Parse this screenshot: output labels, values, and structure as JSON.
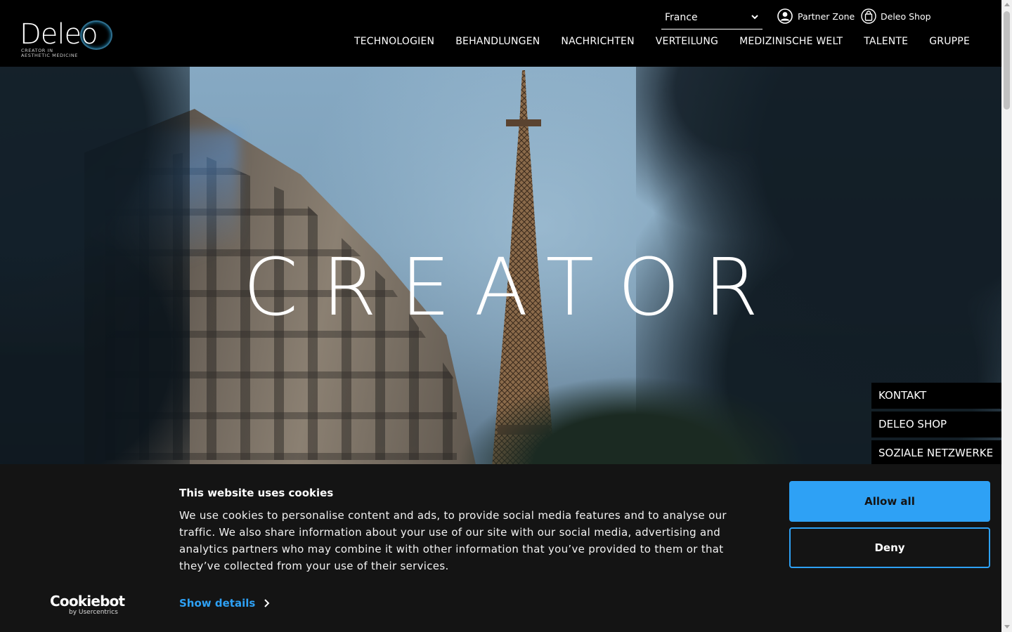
{
  "header": {
    "logo": {
      "word": "Deleo",
      "tagline_1": "CREATOR IN",
      "tagline_2": "AESTHETIC MEDICINE"
    },
    "country_select": {
      "value": "France"
    },
    "top_links": {
      "partner_zone": "Partner Zone",
      "deleo_shop": "Deleo Shop"
    },
    "nav": [
      "TECHNOLOGIEN",
      "BEHANDLUNGEN",
      "NACHRICHTEN",
      "VERTEILUNG",
      "MEDIZINISCHE WELT",
      "TALENTE",
      "GRUPPE"
    ]
  },
  "hero": {
    "title": "CREATOR",
    "side_tabs": [
      "KONTAKT",
      "DELEO SHOP",
      "SOZIALE NETZWERKE"
    ]
  },
  "cookie_banner": {
    "brand": {
      "word": "Cookiebot",
      "sub": "by Usercentrics"
    },
    "title": "This website uses cookies",
    "body": "We use cookies to personalise content and ads, to provide social media features and to analyse our traffic. We also share information about your use of our site with our social media, advertising and analytics partners who may combine it with other information that you’ve provided to them or that they’ve collected from your use of their services.",
    "show_details": "Show details",
    "allow_all": "Allow all",
    "deny": "Deny"
  },
  "colors": {
    "accent": "#2ea1f5",
    "banner_bg": "#141414",
    "header_bg": "#000000"
  },
  "icons": {
    "partner_zone": "user-circle-icon",
    "deleo_shop": "shopping-bag-icon",
    "country_select": "chevron-down-icon",
    "show_details": "chevron-right-icon"
  }
}
